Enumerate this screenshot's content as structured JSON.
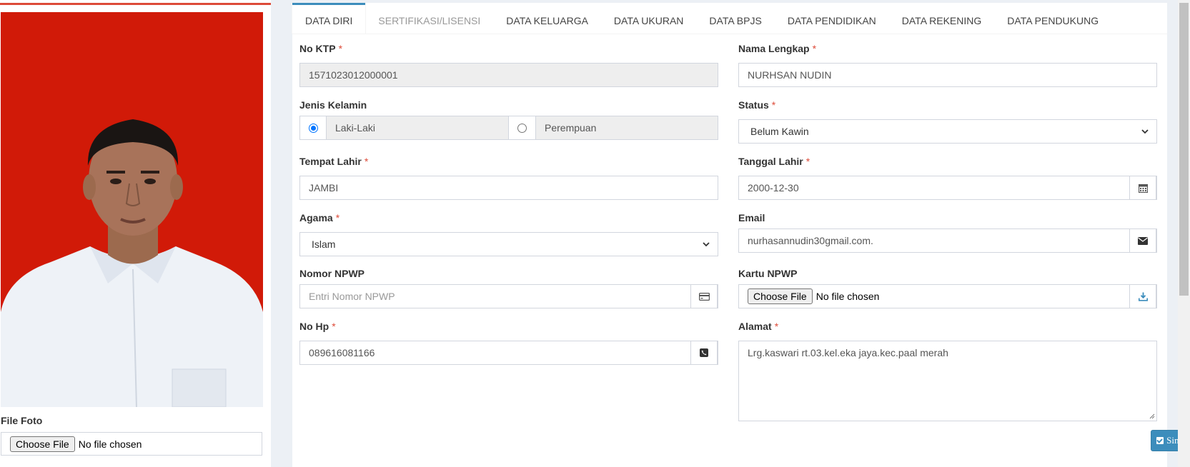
{
  "photo": {
    "alt": "Pas foto karyawan"
  },
  "file_foto": {
    "label": "File Foto",
    "button": "Choose File",
    "status": "No file chosen"
  },
  "tabs": [
    {
      "label": "DATA DIRI"
    },
    {
      "label": "SERTIFIKASI/LISENSI"
    },
    {
      "label": "DATA KELUARGA"
    },
    {
      "label": "DATA UKURAN"
    },
    {
      "label": "DATA BPJS"
    },
    {
      "label": "DATA PENDIDIKAN"
    },
    {
      "label": "DATA REKENING"
    },
    {
      "label": "DATA PENDUKUNG"
    }
  ],
  "required_mark": "*",
  "form": {
    "no_ktp": {
      "label": "No KTP",
      "value": "1571023012000001"
    },
    "nama_lengkap": {
      "label": "Nama Lengkap",
      "value": "NURHSAN NUDIN"
    },
    "jenis_kelamin": {
      "label": "Jenis Kelamin",
      "options": [
        "Laki-Laki",
        "Perempuan"
      ],
      "selected": "Laki-Laki"
    },
    "status": {
      "label": "Status",
      "value": "Belum Kawin"
    },
    "tempat_lahir": {
      "label": "Tempat Lahir",
      "value": "JAMBI"
    },
    "tanggal_lahir": {
      "label": "Tanggal Lahir",
      "value": "2000-12-30",
      "icon": "calendar-icon"
    },
    "agama": {
      "label": "Agama",
      "value": "Islam"
    },
    "email": {
      "label": "Email",
      "value": "nurhasannudin30gmail.com.",
      "icon": "envelope-icon"
    },
    "nomor_npwp": {
      "label": "Nomor NPWP",
      "placeholder": "Entri Nomor NPWP",
      "icon": "credit-card-icon"
    },
    "kartu_npwp": {
      "label": "Kartu NPWP",
      "button": "Choose File",
      "status": "No file chosen",
      "icon": "download-icon"
    },
    "no_hp": {
      "label": "No Hp",
      "value": "089616081166",
      "icon": "phone-icon"
    },
    "alamat": {
      "label": "Alamat",
      "value": "Lrg.kaswari rt.03.kel.eka jaya.kec.paal merah"
    }
  },
  "save_button": "Simpan",
  "colors": {
    "accent": "#3c8dbc",
    "required": "#dd4b39",
    "photo_bg": "#d11a08"
  }
}
